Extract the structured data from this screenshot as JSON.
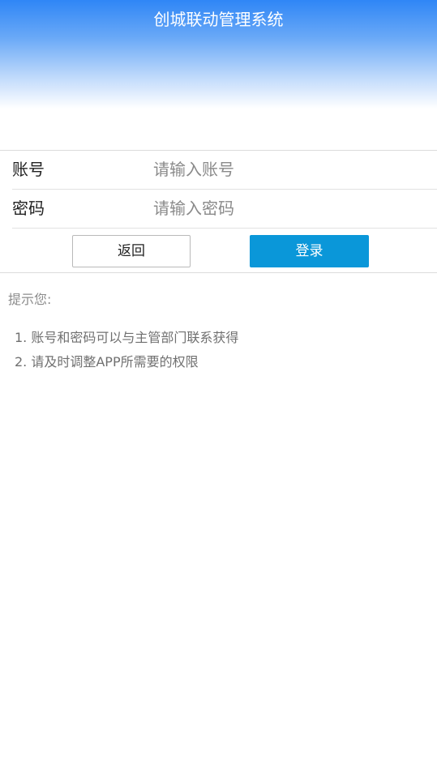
{
  "header": {
    "title": "创城联动管理系统"
  },
  "form": {
    "account": {
      "label": "账号",
      "placeholder": "请输入账号",
      "value": ""
    },
    "password": {
      "label": "密码",
      "placeholder": "请输入密码",
      "value": ""
    }
  },
  "buttons": {
    "back_label": "返回",
    "login_label": "登录"
  },
  "tips": {
    "title": "提示您:",
    "items": [
      "1. 账号和密码可以与主管部门联系获得",
      "2. 请及时调整APP所需要的权限"
    ]
  },
  "colors": {
    "header_gradient_top": "#2f86f6",
    "login_button": "#0a97d9"
  }
}
